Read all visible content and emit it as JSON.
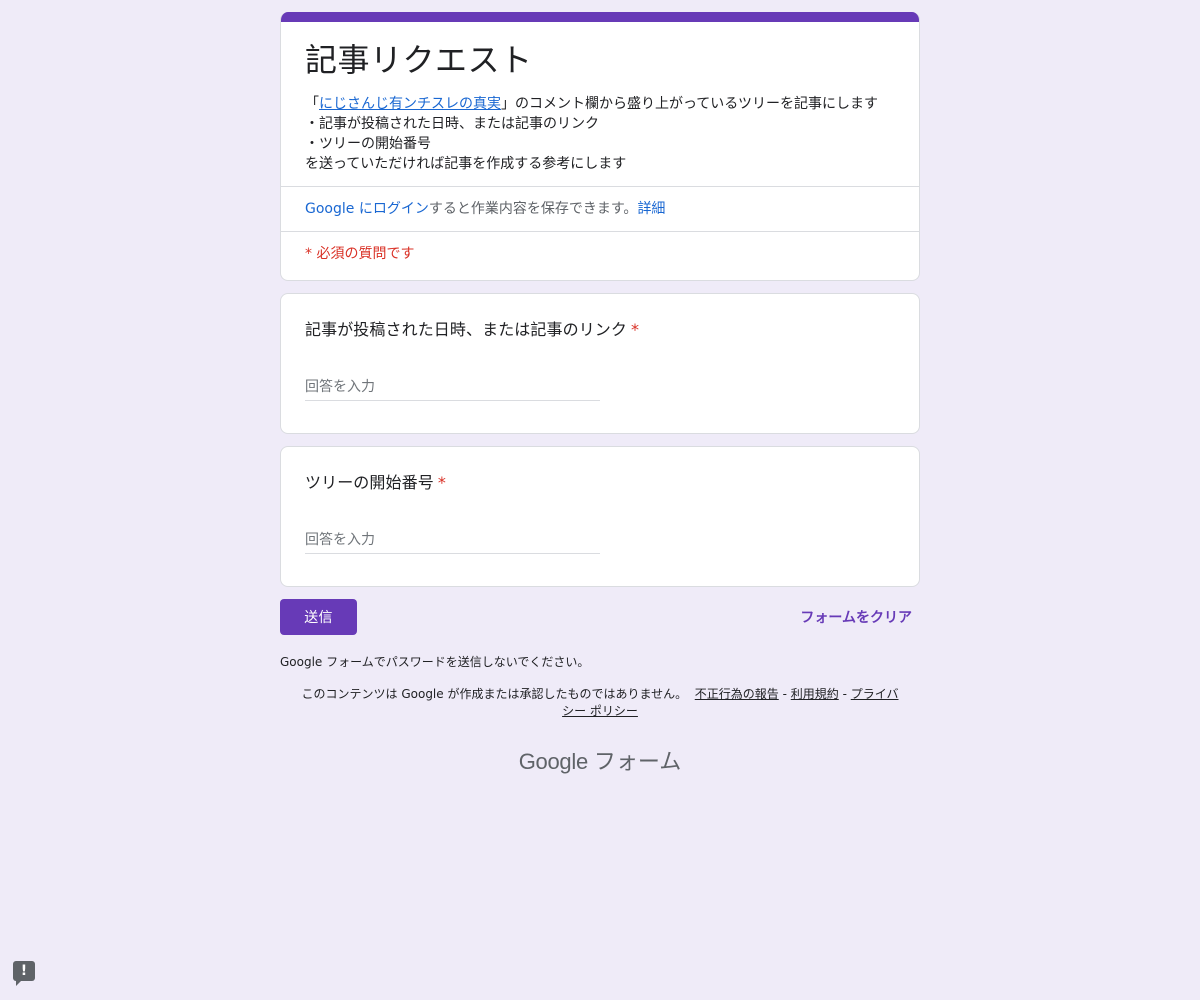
{
  "form": {
    "title": "記事リクエスト",
    "description": {
      "quote_open": "「",
      "link_text": "にじさんじ有ンチスレの真実",
      "quote_close_and_text": "」のコメント欄から盛り上がっているツリーを記事にします",
      "line2": "・記事が投稿された日時、または記事のリンク",
      "line3": "・ツリーの開始番号",
      "line4": "を送っていただければ記事を作成する参考にします"
    },
    "login": {
      "link": "Google にログイン",
      "text": "すると作業内容を保存できます。",
      "details": "詳細"
    },
    "required_note": "* 必須の質問です"
  },
  "questions": [
    {
      "title": "記事が投稿された日時、または記事のリンク",
      "required_mark": "*",
      "placeholder": "回答を入力"
    },
    {
      "title": "ツリーの開始番号",
      "required_mark": "*",
      "placeholder": "回答を入力"
    }
  ],
  "actions": {
    "submit": "送信",
    "clear": "フォームをクリア"
  },
  "footer": {
    "password_note": "Google フォームでパスワードを送信しないでください。",
    "disclaimer": "このコンテンツは Google が作成または承認したものではありません。",
    "report_link": "不正行為の報告",
    "sep": " - ",
    "terms_link": "利用規約",
    "privacy_link": "プライバシー ポリシー",
    "brand_google": "Google",
    "brand_forms": "フォーム"
  },
  "report_icon": {
    "glyph": "!"
  },
  "colors": {
    "accent": "#673ab7",
    "background": "#efebf8",
    "required": "#d93025",
    "link": "#1967d2"
  }
}
